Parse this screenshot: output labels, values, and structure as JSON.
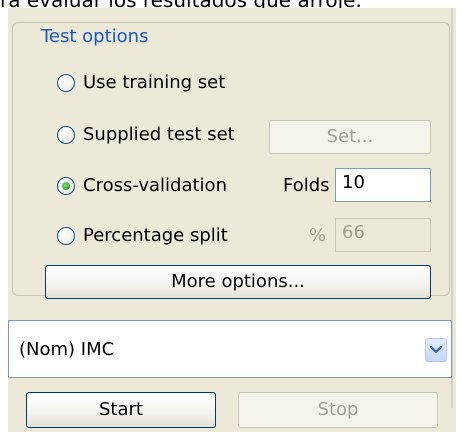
{
  "caption": "ra evaluar los resultados que arroje.",
  "test_options": {
    "title": "Test options",
    "radios": [
      {
        "label": "Use training set",
        "checked": false
      },
      {
        "label": "Supplied test set",
        "checked": false
      },
      {
        "label": "Cross-validation",
        "checked": true
      },
      {
        "label": "Percentage split",
        "checked": false
      }
    ],
    "set_button": "Set...",
    "folds_label": "Folds",
    "folds_value": "10",
    "percent_label": "%",
    "percent_value": "66",
    "more_options_button": "More options..."
  },
  "class_selector": {
    "value": "(Nom) IMC",
    "icon": "chevron-down-icon"
  },
  "actions": {
    "start_label": "Start",
    "stop_label": "Stop"
  },
  "colors": {
    "panel_bg": "#ece9d8",
    "groupbox_title": "#1a58c8",
    "button_border": "#003c74",
    "field_border": "#7f9db9",
    "disabled_text": "#a19f92",
    "radio_checked": "#2ea52a"
  }
}
